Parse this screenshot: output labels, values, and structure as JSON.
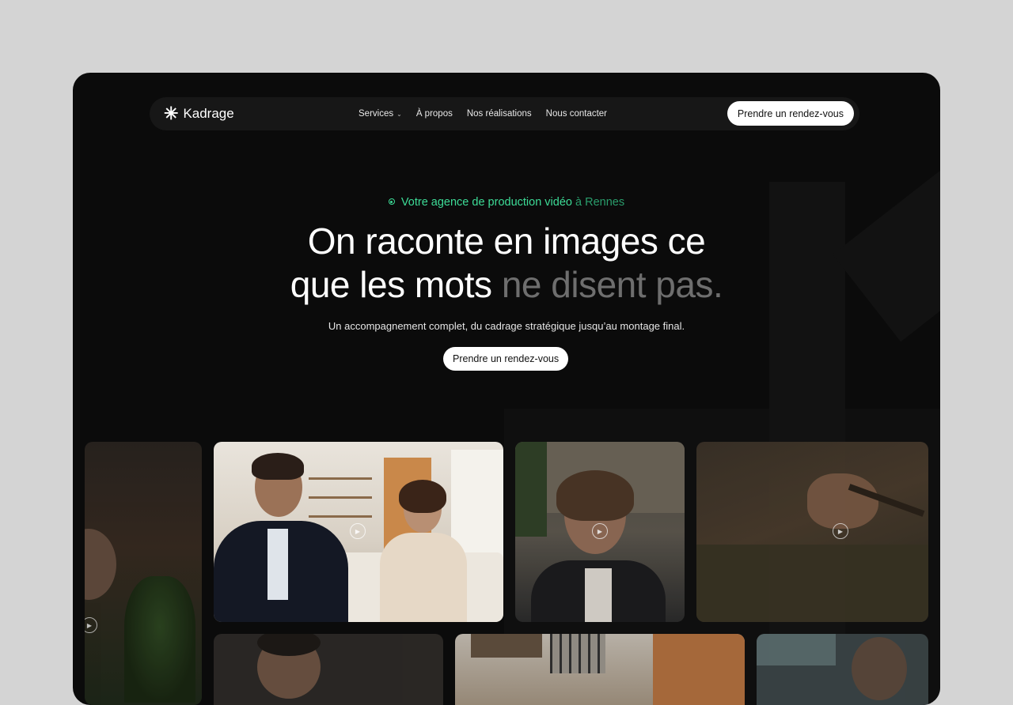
{
  "brand": {
    "name": "Kadrage",
    "logo_glyph": "✳"
  },
  "nav": {
    "items": [
      {
        "label": "Services",
        "has_dropdown": true
      },
      {
        "label": "À propos"
      },
      {
        "label": "Nos réalisations"
      },
      {
        "label": "Nous contacter"
      }
    ],
    "cta": "Prendre un rendez-vous"
  },
  "hero": {
    "tagline_main": "Votre agence de production vidéo",
    "tagline_city": "à Rennes",
    "headline_line1": "On raconte en images ce",
    "headline_line2_white": "que les mots ",
    "headline_line2_muted": "ne disent pas.",
    "subtitle": "Un accompagnement complet, du cadrage stratégique jusqu’au montage final.",
    "cta": "Prendre un rendez-vous"
  },
  "gallery": {
    "videos": [
      {
        "subject": "man speaking with plant, cropped"
      },
      {
        "subject": "business interview on white sofa"
      },
      {
        "subject": "young woman in street"
      },
      {
        "subject": "hands crafting close-up"
      },
      {
        "subject": "man portrait"
      },
      {
        "subject": "building exterior"
      },
      {
        "subject": "man portrait outdoor"
      }
    ]
  },
  "colors": {
    "accent": "#3ddc97",
    "background": "#0b0b0b",
    "nav": "#171717"
  }
}
